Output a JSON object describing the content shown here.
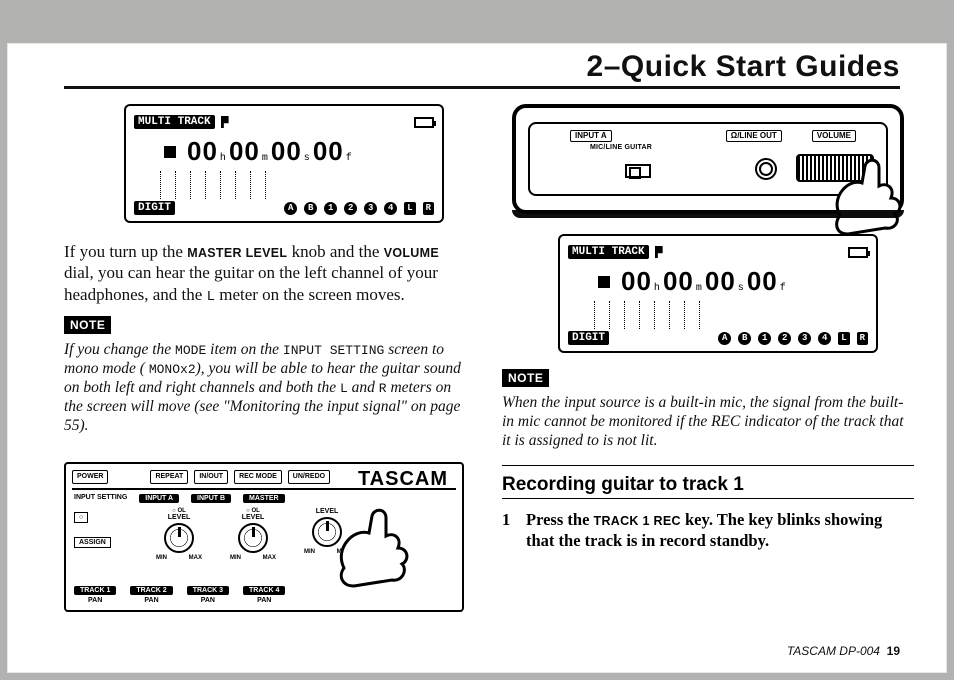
{
  "header": {
    "title": "2–Quick Start Guides"
  },
  "labels": {
    "note": "NOTE"
  },
  "lcd": {
    "mode": "MULTI TRACK",
    "digit": "DIGIT",
    "h": "00",
    "uh": "h",
    "m": "00",
    "um": "m",
    "s": "00",
    "us": "s",
    "f": "00",
    "uf": "f",
    "tracks": [
      "A",
      "B",
      "1",
      "2",
      "3",
      "4",
      "L",
      "R"
    ]
  },
  "left": {
    "p1": {
      "a": "If you turn up the ",
      "master": "MASTER LEVEL",
      "b": " knob and the ",
      "volume": "VOLUME",
      "c": " dial, you can hear the guitar on the left channel of your headphones, and the ",
      "L": "L",
      "d": " meter on the screen moves."
    },
    "note": {
      "a": "If you change the ",
      "mode": "MODE",
      "b": " item on the ",
      "inputsetting": "INPUT SETTING",
      "c": " screen to mono mode (",
      "mono": "MONOx2",
      "c2": "),",
      "d": " you will be able to hear the guitar sound on both left and right channels and both the ",
      "L": "L",
      "e": " and ",
      "R": "R",
      "f": " meters on the screen will move (see \"Monitoring the input signal\" on page 55)."
    }
  },
  "right": {
    "note": "When the input source is a built-in mic, the signal from the built-in mic cannot be monitored if the REC indicator of the track that it is assigned to is not lit.",
    "section": "Recording guitar to track 1",
    "step1": {
      "num": "1",
      "a": "Press the ",
      "key": "TRACK 1 REC",
      "b": " key. The key blinks showing that the track is in record standby."
    }
  },
  "device": {
    "top": {
      "labels": [
        "INPUT A",
        "Ω/LINE OUT",
        "VOLUME"
      ],
      "sub": "MIC/LINE  GUITAR"
    },
    "front": {
      "brand": "TASCAM",
      "buttons": [
        "POWER",
        "REPEAT",
        "IN/OUT",
        "REC MODE",
        "UN/REDO"
      ],
      "labels": [
        "INPUT SETTING",
        "INPUT A",
        "INPUT B",
        "MASTER"
      ],
      "side": [
        "○",
        "ASSIGN"
      ],
      "level": "LEVEL",
      "ol": "OL",
      "min": "MIN",
      "max": "MAX",
      "tracks": [
        "TRACK 1",
        "TRACK 2",
        "TRACK 3",
        "TRACK 4"
      ],
      "pan": "PAN"
    }
  },
  "footer": {
    "model": "TASCAM  DP-004",
    "page": "19"
  }
}
